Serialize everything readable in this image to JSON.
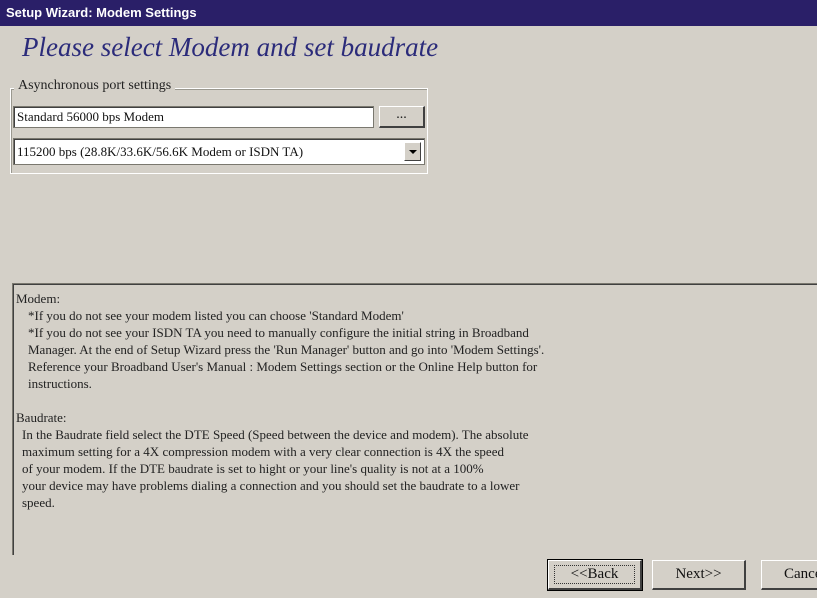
{
  "window": {
    "title": "Setup Wizard: Modem Settings"
  },
  "page": {
    "heading": "Please select Modem and set baudrate"
  },
  "port_settings": {
    "group_label": "Asynchronous port settings",
    "modem_value": "Standard 56000 bps Modem",
    "browse_label": "...",
    "baudrate_value": "115200 bps (28.8K/33.6K/56.6K Modem or ISDN TA)"
  },
  "help": {
    "lines": [
      "Modem:",
      "*If you do not see your modem listed you can choose 'Standard Modem'",
      "*If you do not see your ISDN TA you need to manually configure the initial string in Broadband",
      "Manager.  At the end of Setup Wizard press the 'Run Manager' button and go into 'Modem Settings'.",
      "Reference your Broadband User's Manual : Modem Settings section or the Online Help button for",
      "instructions.",
      "Baudrate:",
      "In the Baudrate field select the DTE Speed (Speed between the device and modem).  The absolute",
      "maximum setting for a 4X compression modem with a very clear connection is 4X the speed",
      "of your modem. If the DTE baudrate is set to hight or your line's quality is not at a 100%",
      "your device may have problems dialing a connection and you should set the baudrate to a lower",
      "speed."
    ]
  },
  "buttons": {
    "back": "<<Back",
    "next": "Next>>",
    "cancel": "Cancel"
  },
  "colors": {
    "titlebar": "#2a1f68",
    "heading": "#2b2b7a",
    "dialog_background": "#d4d0c8"
  }
}
